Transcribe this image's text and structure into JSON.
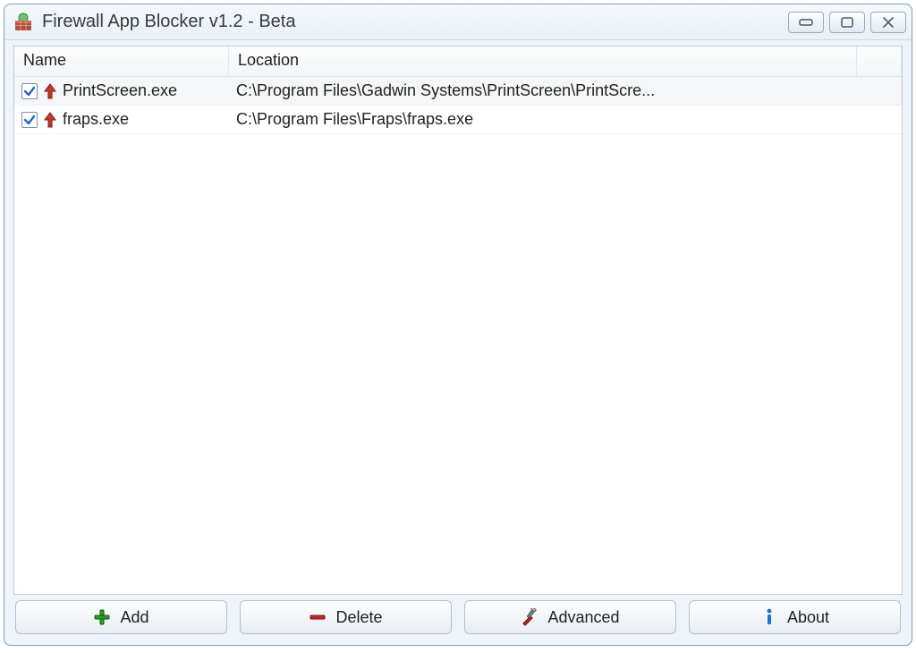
{
  "window": {
    "title": "Firewall App Blocker v1.2 - Beta"
  },
  "columns": {
    "name": "Name",
    "location": "Location"
  },
  "rows": [
    {
      "checked": true,
      "name": "PrintScreen.exe",
      "location": "C:\\Program Files\\Gadwin Systems\\PrintScreen\\PrintScre...",
      "selected": true
    },
    {
      "checked": true,
      "name": "fraps.exe",
      "location": "C:\\Program Files\\Fraps\\fraps.exe",
      "selected": false
    }
  ],
  "buttons": {
    "add": "Add",
    "delete": "Delete",
    "advanced": "Advanced",
    "about": "About"
  }
}
